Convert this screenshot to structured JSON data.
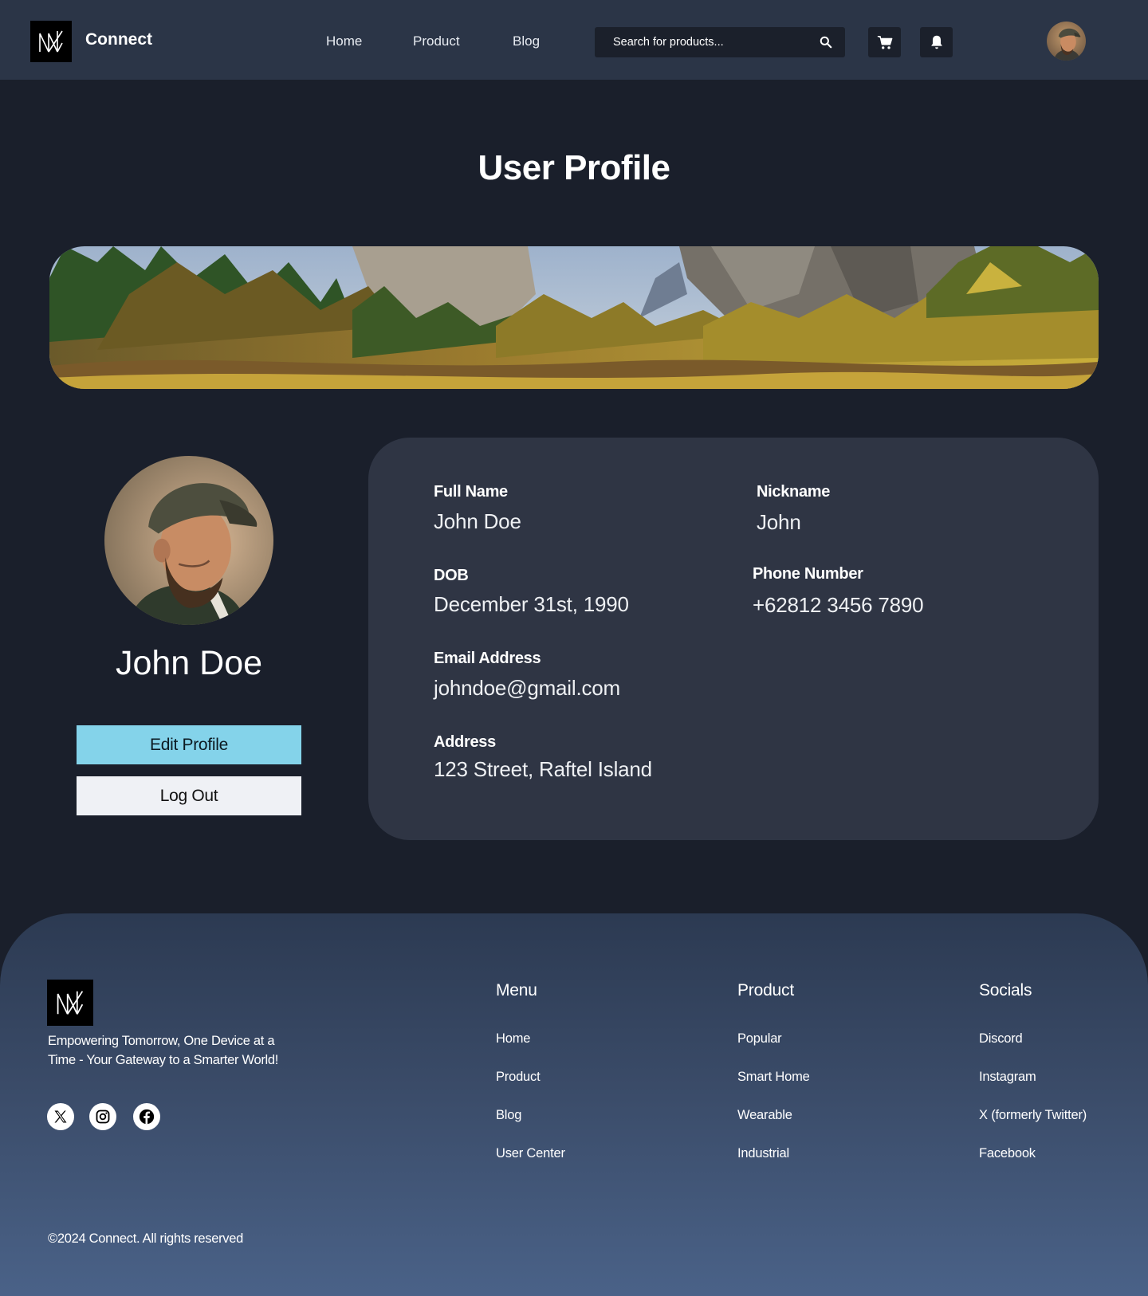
{
  "header": {
    "brand": "Connect",
    "nav": [
      "Home",
      "Product",
      "Blog"
    ],
    "search_placeholder": "Search for products..."
  },
  "page": {
    "title": "User Profile"
  },
  "profile": {
    "name": "John Doe",
    "edit_button": "Edit Profile",
    "logout_button": "Log Out"
  },
  "info": {
    "full_name_label": "Full Name",
    "full_name_value": "John Doe",
    "nickname_label": "Nickname",
    "nickname_value": "John",
    "dob_label": "DOB",
    "dob_value": "December 31st, 1990",
    "phone_label": "Phone Number",
    "phone_value": "+62812 3456 7890",
    "email_label": "Email Address",
    "email_value": "johndoe@gmail.com",
    "address_label": "Address",
    "address_value": "123 Street, Raftel Island"
  },
  "footer": {
    "tagline": "Empowering Tomorrow, One Device at a Time - Your Gateway to a Smarter World!",
    "menu": {
      "title": "Menu",
      "items": [
        "Home",
        "Product",
        "Blog",
        "User Center"
      ]
    },
    "product": {
      "title": "Product",
      "items": [
        "Popular",
        "Smart Home",
        "Wearable",
        "Industrial"
      ]
    },
    "socials": {
      "title": "Socials",
      "items": [
        "Discord",
        "Instagram",
        "X (formerly Twitter)",
        "Facebook"
      ]
    },
    "copyright": "©2024 Connect. All rights reserved"
  },
  "icons": {
    "logo": "nn-logo-icon",
    "search": "search-icon",
    "cart": "cart-icon",
    "notification": "bell-icon",
    "social": [
      "x-icon",
      "instagram-icon",
      "facebook-icon"
    ]
  },
  "colors": {
    "header_bg": "#2b3547",
    "page_bg": "#1a1f2b",
    "card_bg": "#2f3544",
    "accent": "#84d3ea"
  }
}
